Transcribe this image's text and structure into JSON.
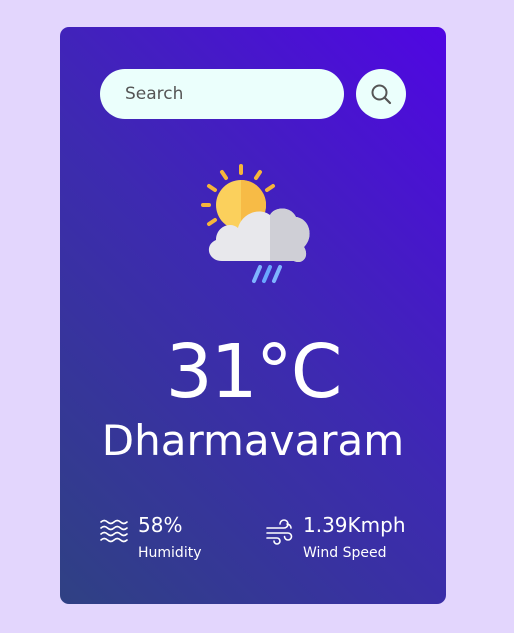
{
  "colors": {
    "page_background": "#e3d6fd",
    "card_gradient_top": "#5006e3",
    "card_gradient_bottom": "#2f4183",
    "input_background": "#ebfffc",
    "text": "#ffffff"
  },
  "search": {
    "placeholder": "Search",
    "value": "",
    "button_icon": "search-icon"
  },
  "weather": {
    "condition_icon": "sun-cloud-rain-icon",
    "temperature": "31°C",
    "city": "Dharmavaram"
  },
  "details": {
    "humidity": {
      "icon": "humidity-waves-icon",
      "value": "58%",
      "label": "Humidity"
    },
    "wind": {
      "icon": "wind-icon",
      "value": "1.39Kmph",
      "label": "Wind Speed"
    }
  }
}
